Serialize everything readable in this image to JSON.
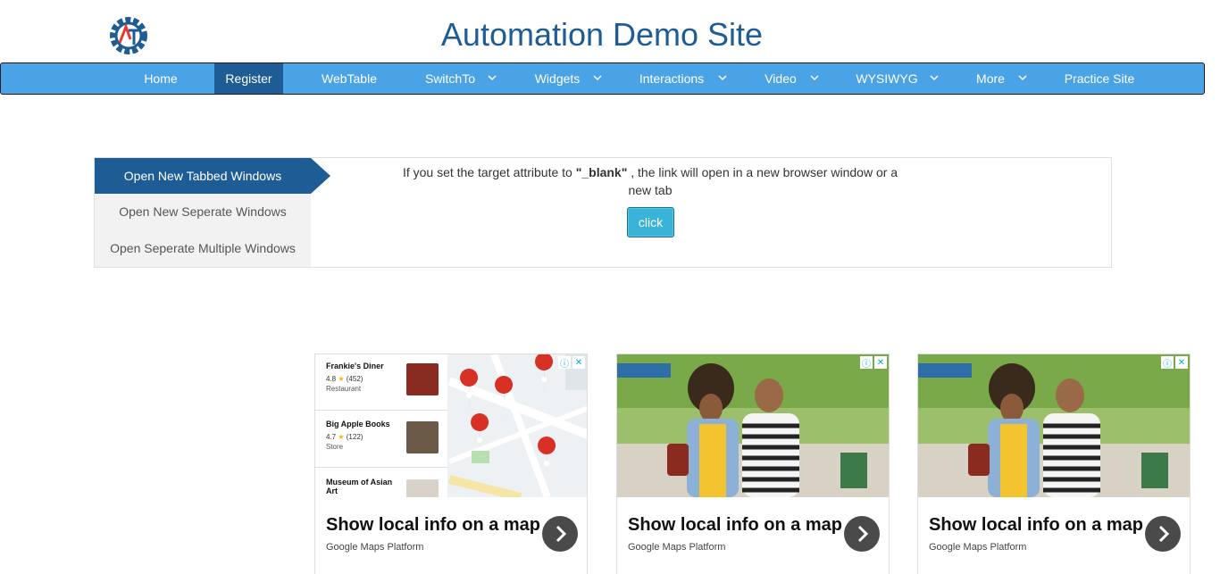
{
  "header": {
    "title": "Automation Demo Site",
    "logo_letters": "AT"
  },
  "nav": {
    "items": [
      {
        "label": "Home",
        "dropdown": false,
        "active": false
      },
      {
        "label": "Register",
        "dropdown": false,
        "active": true
      },
      {
        "label": "WebTable",
        "dropdown": false,
        "active": false
      },
      {
        "label": "SwitchTo",
        "dropdown": true,
        "active": false
      },
      {
        "label": "Widgets",
        "dropdown": true,
        "active": false
      },
      {
        "label": "Interactions",
        "dropdown": true,
        "active": false
      },
      {
        "label": "Video",
        "dropdown": true,
        "active": false
      },
      {
        "label": "WYSIWYG",
        "dropdown": true,
        "active": false
      },
      {
        "label": "More",
        "dropdown": true,
        "active": false
      },
      {
        "label": "Practice Site",
        "dropdown": false,
        "active": false
      }
    ]
  },
  "windows": {
    "tabs": [
      {
        "label": "Open New Tabbed Windows",
        "active": true
      },
      {
        "label": "Open New Seperate Windows",
        "active": false
      },
      {
        "label": "Open Seperate Multiple Windows",
        "active": false
      }
    ],
    "description_pre": "If you set the target attribute to ",
    "description_bold": "\"_blank\"",
    "description_post": " , the link will open in a new browser window or a new tab",
    "button_label": "click"
  },
  "ads": [
    {
      "kind": "map",
      "title": "Show local info on a map",
      "subtitle": "Google Maps Platform",
      "places": [
        {
          "name": "Frankie's Diner",
          "rating": "4.8",
          "reviews": "(452)",
          "type": "Restaurant"
        },
        {
          "name": "Big Apple Books",
          "rating": "4.7",
          "reviews": "(122)",
          "type": "Store"
        },
        {
          "name": "Museum of Asian Art",
          "rating": "",
          "reviews": "",
          "type": ""
        }
      ]
    },
    {
      "kind": "photo",
      "title": "Show local info on a map",
      "subtitle": "Google Maps Platform"
    },
    {
      "kind": "photo",
      "title": "Show local info on a map",
      "subtitle": "Google Maps Platform"
    }
  ],
  "colors": {
    "brand": "#1d5c95",
    "nav_bg": "#4aa3e6",
    "button": "#39b3d7"
  }
}
